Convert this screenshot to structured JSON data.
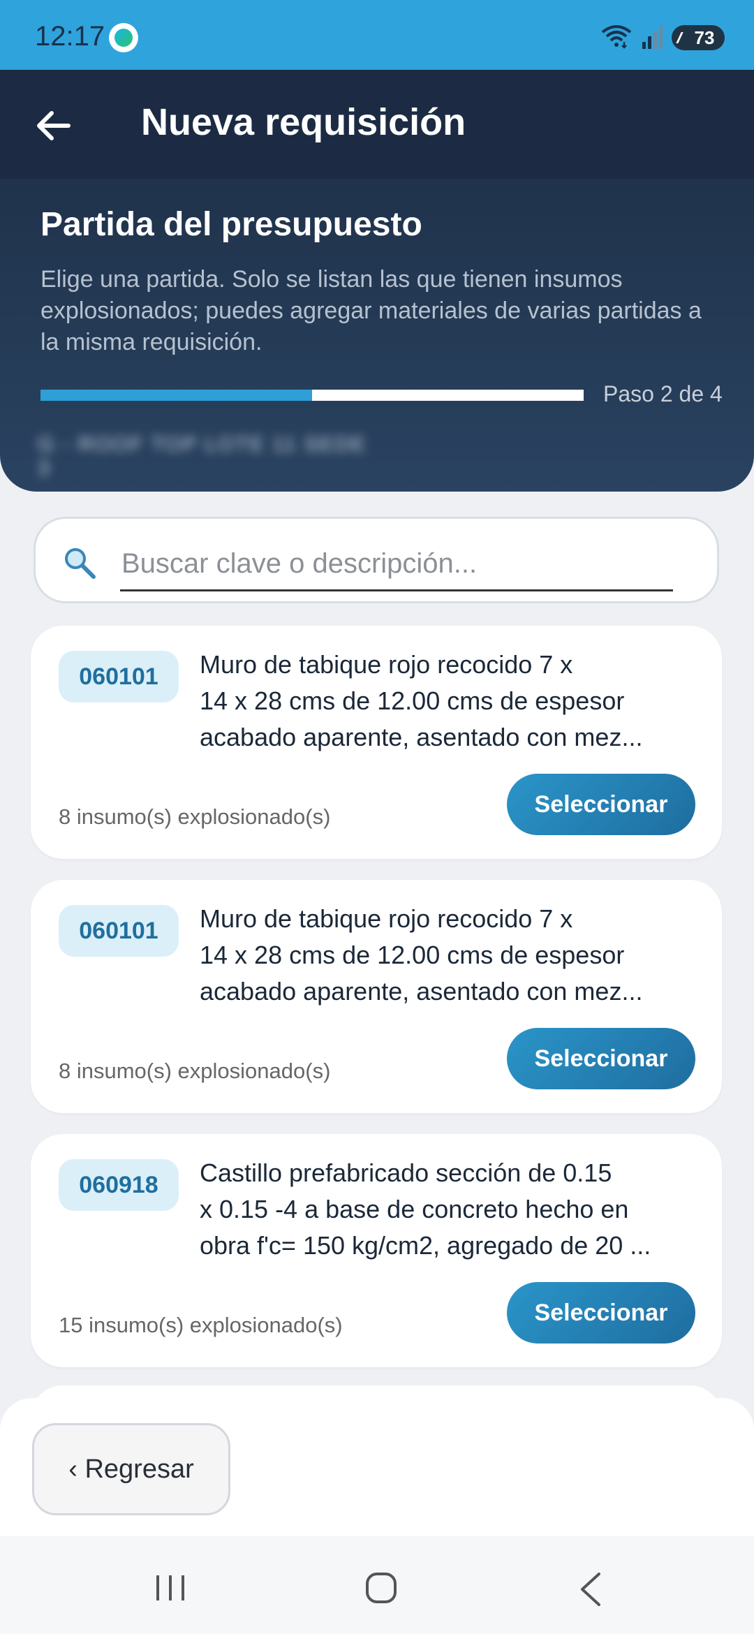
{
  "status_bar": {
    "time": "12:17",
    "battery": "73"
  },
  "header": {
    "title": "Nueva requisición",
    "section_title": "Partida del presupuesto",
    "section_desc": "Elige una partida. Solo se listan las que tienen insumos explosionados; puedes agregar materiales de varias partidas a la misma requisición.",
    "progress_fraction": 0.5,
    "step_label": "Paso 2 de 4",
    "blurred_subtitle": "G - ROOF TOP LOTE 11 SEDE 3"
  },
  "search": {
    "placeholder": "Buscar clave o descripción..."
  },
  "cards": [
    {
      "code": "060101",
      "desc": "Muro de tabique rojo recocido 7 x\n14 x 28 cms de 12.00 cms de espesor\nacabado aparente,  asentado con mez...",
      "meta": "8 insumo(s) explosionado(s)",
      "button": "Seleccionar"
    },
    {
      "code": "060101",
      "desc": "Muro de tabique rojo recocido 7 x\n14 x 28 cms de 12.00 cms de espesor\nacabado aparente,  asentado con mez...",
      "meta": "8 insumo(s) explosionado(s)",
      "button": "Seleccionar"
    },
    {
      "code": "060918",
      "desc": "Castillo prefabricado sección  de 0.15\nx 0.15 -4 a base de concreto hecho en\nobra f'c= 150 kg/cm2, agregado de 20 ...",
      "meta": "15 insumo(s) explosionado(s)",
      "button": "Seleccionar"
    }
  ],
  "footer": {
    "back_label": "‹ Regresar"
  },
  "icons": {
    "back": "arrow-left-icon",
    "search": "magnifier-icon",
    "nav_recents": "recents-icon",
    "nav_home": "home-icon",
    "nav_back": "back-chevron-icon"
  },
  "colors": {
    "status_bar": "#2fa3dc",
    "header_bg": "#1d2d46",
    "progress_fill": "#2f9fd8",
    "button": "#2a95c9",
    "badge_bg": "#dbeff9",
    "badge_text": "#1f6f9e"
  }
}
